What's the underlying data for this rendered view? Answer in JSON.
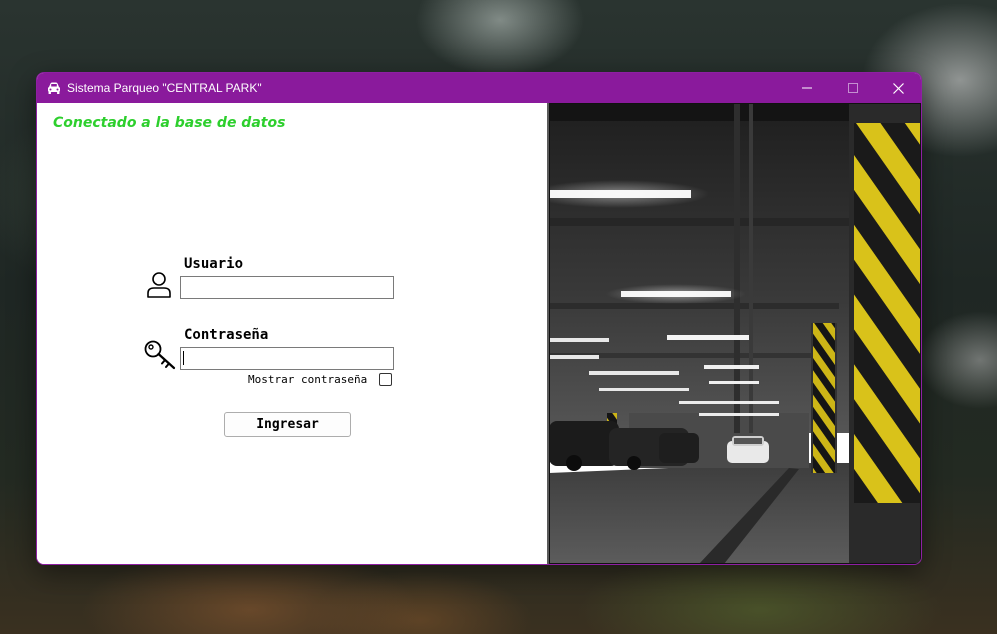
{
  "window": {
    "title": "Sistema Parqueo \"CENTRAL PARK\"",
    "accent_color": "#8a1a9c",
    "icons": {
      "app": "car-icon",
      "minimize": "minimize-icon",
      "maximize": "maximize-icon",
      "close": "close-icon"
    }
  },
  "status": {
    "text": "Conectado a la base de datos",
    "color": "#2dcf2d"
  },
  "login": {
    "user_label": "Usuario",
    "user_value": "",
    "user_icon": "user-icon",
    "password_label": "Contraseña",
    "password_value": "",
    "password_icon": "key-icon",
    "show_password_label": "Mostrar contraseña",
    "show_password_checked": false,
    "submit_label": "Ingresar"
  },
  "image": {
    "subject": "parking-garage-photo"
  }
}
